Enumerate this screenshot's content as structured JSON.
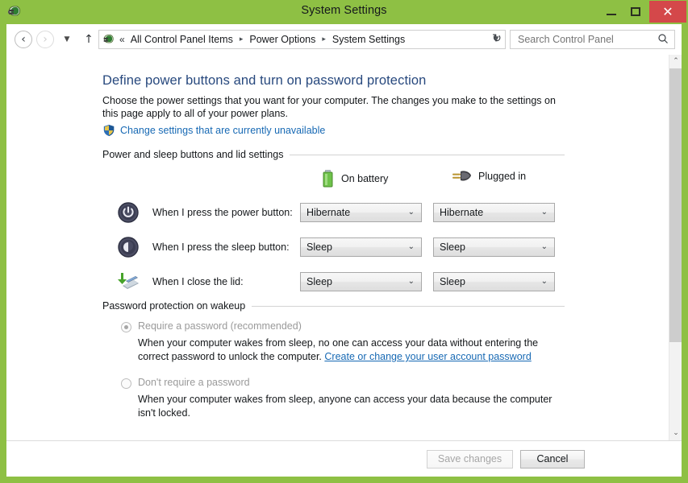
{
  "window": {
    "title": "System Settings",
    "icon": "power-plug-icon",
    "accent_green": "#8ec044",
    "close_red": "#d4484a",
    "controls": {
      "minimize": "–",
      "maximize": "▢",
      "close": "✕"
    }
  },
  "nav": {
    "back": "‹",
    "forward": "›",
    "history_dropdown": "▼",
    "up": "↑",
    "refresh": "↻",
    "crumb_prefix": "«",
    "crumb_dropdown": "▼",
    "breadcrumb": [
      "All Control Panel Items",
      "Power Options",
      "System Settings"
    ],
    "separator": "▸"
  },
  "search": {
    "placeholder": "Search Control Panel",
    "value": "",
    "icon": "search-icon"
  },
  "page": {
    "heading": "Define power buttons and turn on password protection",
    "description": "Choose the power settings that you want for your computer. The changes you make to the settings on this page apply to all of your power plans.",
    "uac_link": "Change settings that are currently unavailable",
    "heading_color": "#28497e",
    "link_color": "#1769b4"
  },
  "power_section": {
    "group_label": "Power and sleep buttons and lid settings",
    "columns": [
      {
        "label": "On battery",
        "icon": "battery-icon"
      },
      {
        "label": "Plugged in",
        "icon": "power-plug-icon"
      }
    ],
    "rows": [
      {
        "icon": "power-button-icon",
        "label": "When I press the power button:",
        "on_battery": "Hibernate",
        "plugged_in": "Hibernate"
      },
      {
        "icon": "sleep-button-icon",
        "label": "When I press the sleep button:",
        "on_battery": "Sleep",
        "plugged_in": "Sleep"
      },
      {
        "icon": "close-lid-icon",
        "label": "When I close the lid:",
        "on_battery": "Sleep",
        "plugged_in": "Sleep"
      }
    ],
    "dropdown_arrow": "⌄"
  },
  "password_section": {
    "group_label": "Password protection on wakeup",
    "options": [
      {
        "label": "Require a password (recommended)",
        "selected": true,
        "description_before": "When your computer wakes from sleep, no one can access your data without entering the correct password to unlock the computer. ",
        "link": "Create or change your user account password",
        "description_after": ""
      },
      {
        "label": "Don't require a password",
        "selected": false,
        "description_before": "When your computer wakes from sleep, anyone can access your data because the computer isn't locked.",
        "link": "",
        "description_after": ""
      }
    ]
  },
  "footer": {
    "save_label": "Save changes",
    "save_enabled": false,
    "cancel_label": "Cancel",
    "cancel_enabled": true
  },
  "scrollbar": {
    "up_arrow": "⌃",
    "down_arrow": "⌄"
  }
}
